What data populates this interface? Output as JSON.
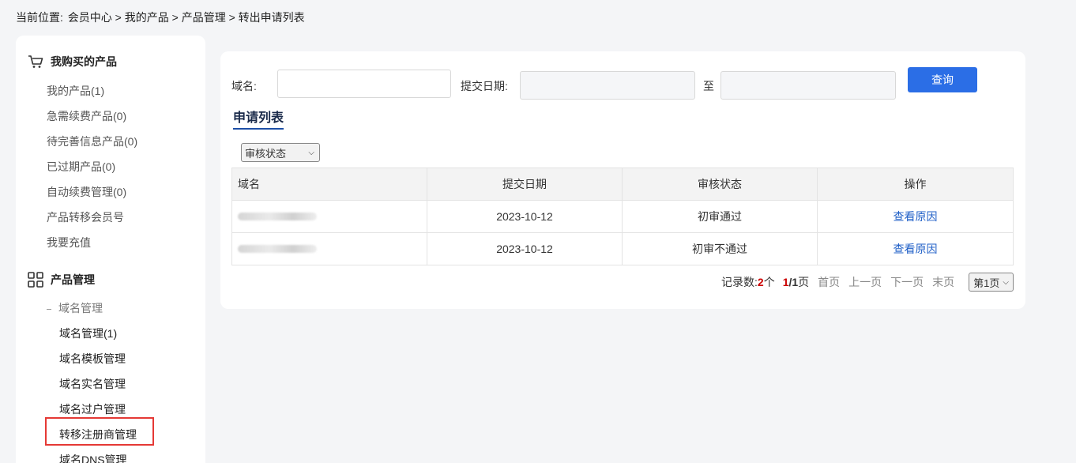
{
  "breadcrumb": {
    "prefix": "当前位置:",
    "path": "会员中心 > 我的产品 > 产品管理 > 转出申请列表"
  },
  "sidebar": {
    "section1": {
      "title": "我购买的产品",
      "icon": "cart-icon",
      "items": [
        "我的产品(1)",
        "急需续费产品(0)",
        "待完善信息产品(0)",
        "已过期产品(0)",
        "自动续费管理(0)",
        "产品转移会员号",
        "我要充值"
      ]
    },
    "section2": {
      "title": "产品管理",
      "icon": "grid-icon",
      "group": "域名管理",
      "items": [
        "域名管理(1)",
        "域名模板管理",
        "域名实名管理",
        "域名过户管理",
        "转移注册商管理",
        "域名DNS管理"
      ]
    }
  },
  "search": {
    "domain_label": "域名:",
    "domain_value": "",
    "date_label": "提交日期:",
    "date_from": "",
    "to_label": "至",
    "date_to": "",
    "query_button": "查询"
  },
  "list": {
    "title": "申请列表",
    "status_filter": "审核状态",
    "columns": [
      "域名",
      "提交日期",
      "审核状态",
      "操作"
    ],
    "rows": [
      {
        "date": "2023-10-12",
        "status": "初审通过",
        "action": "查看原因"
      },
      {
        "date": "2023-10-12",
        "status": "初审不通过",
        "action": "查看原因"
      }
    ]
  },
  "pager": {
    "records_label": "记录数:",
    "records_count": "2",
    "records_unit": "个",
    "page_current": "1",
    "page_sep": "/",
    "page_total": "1",
    "page_unit": "页",
    "first": "首页",
    "prev": "上一页",
    "next": "下一页",
    "last": "末页",
    "page_select": "第1页"
  },
  "colors": {
    "accent": "#2b6ee6",
    "link": "#1f5fc7",
    "highlight_border": "#e53935",
    "count_red": "#cc0000"
  }
}
